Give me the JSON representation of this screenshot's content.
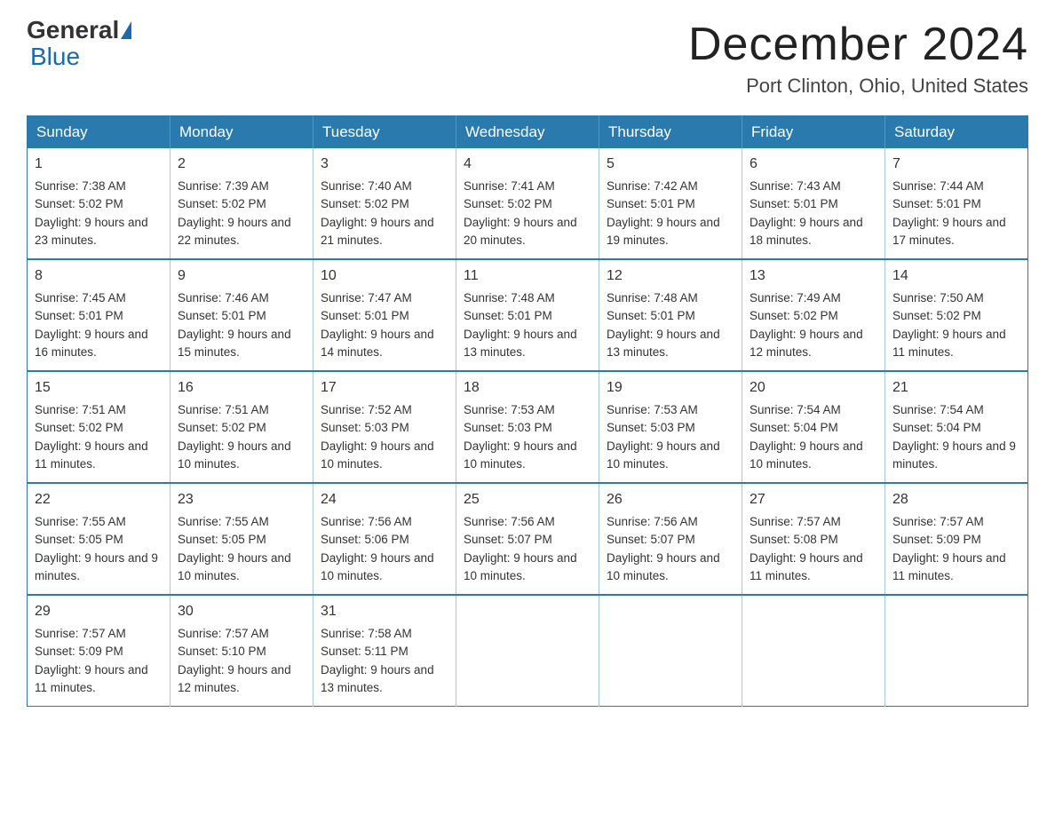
{
  "header": {
    "logo_general": "General",
    "logo_blue": "Blue",
    "month_title": "December 2024",
    "location": "Port Clinton, Ohio, United States"
  },
  "weekdays": [
    "Sunday",
    "Monday",
    "Tuesday",
    "Wednesday",
    "Thursday",
    "Friday",
    "Saturday"
  ],
  "weeks": [
    [
      {
        "day": "1",
        "sunrise": "7:38 AM",
        "sunset": "5:02 PM",
        "daylight": "9 hours and 23 minutes."
      },
      {
        "day": "2",
        "sunrise": "7:39 AM",
        "sunset": "5:02 PM",
        "daylight": "9 hours and 22 minutes."
      },
      {
        "day": "3",
        "sunrise": "7:40 AM",
        "sunset": "5:02 PM",
        "daylight": "9 hours and 21 minutes."
      },
      {
        "day": "4",
        "sunrise": "7:41 AM",
        "sunset": "5:02 PM",
        "daylight": "9 hours and 20 minutes."
      },
      {
        "day": "5",
        "sunrise": "7:42 AM",
        "sunset": "5:01 PM",
        "daylight": "9 hours and 19 minutes."
      },
      {
        "day": "6",
        "sunrise": "7:43 AM",
        "sunset": "5:01 PM",
        "daylight": "9 hours and 18 minutes."
      },
      {
        "day": "7",
        "sunrise": "7:44 AM",
        "sunset": "5:01 PM",
        "daylight": "9 hours and 17 minutes."
      }
    ],
    [
      {
        "day": "8",
        "sunrise": "7:45 AM",
        "sunset": "5:01 PM",
        "daylight": "9 hours and 16 minutes."
      },
      {
        "day": "9",
        "sunrise": "7:46 AM",
        "sunset": "5:01 PM",
        "daylight": "9 hours and 15 minutes."
      },
      {
        "day": "10",
        "sunrise": "7:47 AM",
        "sunset": "5:01 PM",
        "daylight": "9 hours and 14 minutes."
      },
      {
        "day": "11",
        "sunrise": "7:48 AM",
        "sunset": "5:01 PM",
        "daylight": "9 hours and 13 minutes."
      },
      {
        "day": "12",
        "sunrise": "7:48 AM",
        "sunset": "5:01 PM",
        "daylight": "9 hours and 13 minutes."
      },
      {
        "day": "13",
        "sunrise": "7:49 AM",
        "sunset": "5:02 PM",
        "daylight": "9 hours and 12 minutes."
      },
      {
        "day": "14",
        "sunrise": "7:50 AM",
        "sunset": "5:02 PM",
        "daylight": "9 hours and 11 minutes."
      }
    ],
    [
      {
        "day": "15",
        "sunrise": "7:51 AM",
        "sunset": "5:02 PM",
        "daylight": "9 hours and 11 minutes."
      },
      {
        "day": "16",
        "sunrise": "7:51 AM",
        "sunset": "5:02 PM",
        "daylight": "9 hours and 10 minutes."
      },
      {
        "day": "17",
        "sunrise": "7:52 AM",
        "sunset": "5:03 PM",
        "daylight": "9 hours and 10 minutes."
      },
      {
        "day": "18",
        "sunrise": "7:53 AM",
        "sunset": "5:03 PM",
        "daylight": "9 hours and 10 minutes."
      },
      {
        "day": "19",
        "sunrise": "7:53 AM",
        "sunset": "5:03 PM",
        "daylight": "9 hours and 10 minutes."
      },
      {
        "day": "20",
        "sunrise": "7:54 AM",
        "sunset": "5:04 PM",
        "daylight": "9 hours and 10 minutes."
      },
      {
        "day": "21",
        "sunrise": "7:54 AM",
        "sunset": "5:04 PM",
        "daylight": "9 hours and 9 minutes."
      }
    ],
    [
      {
        "day": "22",
        "sunrise": "7:55 AM",
        "sunset": "5:05 PM",
        "daylight": "9 hours and 9 minutes."
      },
      {
        "day": "23",
        "sunrise": "7:55 AM",
        "sunset": "5:05 PM",
        "daylight": "9 hours and 10 minutes."
      },
      {
        "day": "24",
        "sunrise": "7:56 AM",
        "sunset": "5:06 PM",
        "daylight": "9 hours and 10 minutes."
      },
      {
        "day": "25",
        "sunrise": "7:56 AM",
        "sunset": "5:07 PM",
        "daylight": "9 hours and 10 minutes."
      },
      {
        "day": "26",
        "sunrise": "7:56 AM",
        "sunset": "5:07 PM",
        "daylight": "9 hours and 10 minutes."
      },
      {
        "day": "27",
        "sunrise": "7:57 AM",
        "sunset": "5:08 PM",
        "daylight": "9 hours and 11 minutes."
      },
      {
        "day": "28",
        "sunrise": "7:57 AM",
        "sunset": "5:09 PM",
        "daylight": "9 hours and 11 minutes."
      }
    ],
    [
      {
        "day": "29",
        "sunrise": "7:57 AM",
        "sunset": "5:09 PM",
        "daylight": "9 hours and 11 minutes."
      },
      {
        "day": "30",
        "sunrise": "7:57 AM",
        "sunset": "5:10 PM",
        "daylight": "9 hours and 12 minutes."
      },
      {
        "day": "31",
        "sunrise": "7:58 AM",
        "sunset": "5:11 PM",
        "daylight": "9 hours and 13 minutes."
      },
      null,
      null,
      null,
      null
    ]
  ],
  "labels": {
    "sunrise": "Sunrise: ",
    "sunset": "Sunset: ",
    "daylight": "Daylight: "
  }
}
